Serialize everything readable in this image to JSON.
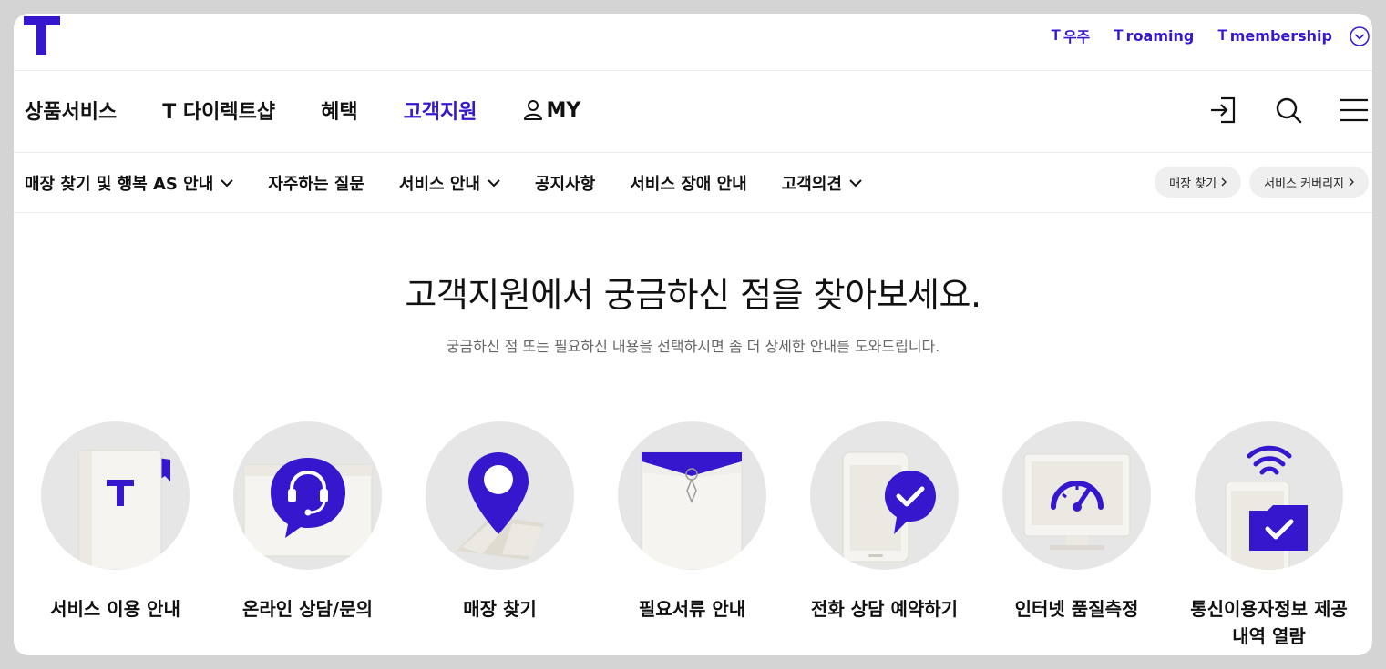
{
  "colors": {
    "brand": "#3617CE",
    "circle_bg": "#E6E6E6",
    "paper": "#F5F4F0"
  },
  "util_links": [
    {
      "mark": "T",
      "label": "우주"
    },
    {
      "mark": "T",
      "label": "roaming"
    },
    {
      "mark": "T",
      "label": "membership"
    }
  ],
  "gnb": {
    "items": [
      "상품서비스",
      "T 다이렉트샵",
      "혜택",
      "고객지원",
      "MY"
    ],
    "active_index": 3,
    "icons": [
      "login-icon",
      "search-icon",
      "menu-icon"
    ]
  },
  "subnav": {
    "items": [
      "매장 찾기 및 행복 AS 안내",
      "자주하는 질문",
      "서비스 안내",
      "공지사항",
      "서비스 장애 안내",
      "고객의견"
    ],
    "quick": [
      "매장 찾기",
      "서비스 커버리지"
    ]
  },
  "hero": {
    "title": "고객지원에서 궁금하신 점을 찾아보세요.",
    "subtitle": "궁금하신 점 또는 필요하신 내용을 선택하시면 좀 더 상세한 안내를 도와드립니다."
  },
  "services": [
    {
      "label": "서비스 이용 안내",
      "icon": "guide-book-icon"
    },
    {
      "label": "온라인 상담/문의",
      "icon": "headset-chat-icon"
    },
    {
      "label": "매장 찾기",
      "icon": "map-pin-icon"
    },
    {
      "label": "필요서류 안내",
      "icon": "document-envelope-icon"
    },
    {
      "label": "전화 상담 예약하기",
      "icon": "phone-check-icon"
    },
    {
      "label": "인터넷 품질측정",
      "icon": "speedometer-monitor-icon"
    },
    {
      "label": "통신이용자정보 제공\n내역 열람",
      "icon": "wifi-folder-check-icon"
    }
  ]
}
